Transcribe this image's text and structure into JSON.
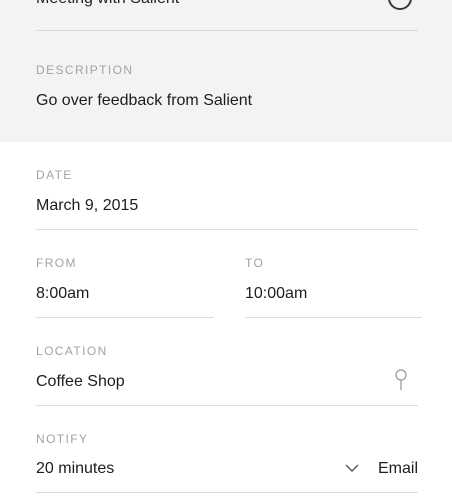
{
  "title": {
    "text": "Meeting with Salient",
    "icon": "circle-icon"
  },
  "description": {
    "label": "DESCRIPTION",
    "value": "Go over feedback from Salient"
  },
  "date": {
    "label": "DATE",
    "value": "March 9, 2015"
  },
  "from": {
    "label": "FROM",
    "value": "8:00am"
  },
  "to": {
    "label": "TO",
    "value": "10:00am"
  },
  "location": {
    "label": "LOCATION",
    "value": "Coffee Shop",
    "icon": "map-pin-icon"
  },
  "notify": {
    "label": "NOTIFY",
    "value": "20 minutes",
    "icon": "chevron-down-icon",
    "method": "Email"
  },
  "colors": {
    "top_background": "#f3f3f4",
    "label": "#a3a3a6",
    "divider": "#dcdcde",
    "text": "#1d1d1f"
  }
}
